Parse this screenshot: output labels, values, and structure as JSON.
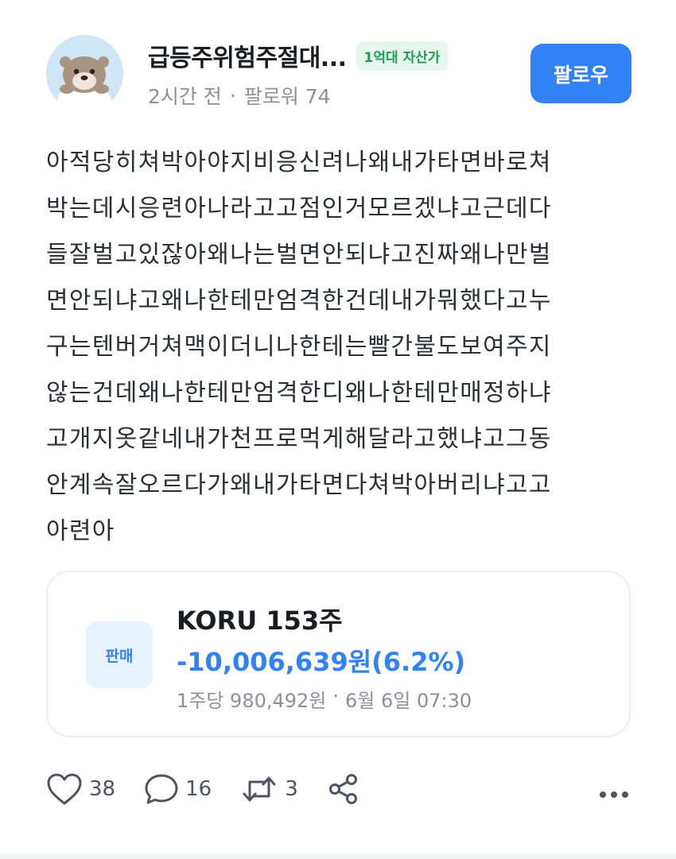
{
  "author": {
    "name": "급등주위험주절대...",
    "badge": "1억대 자산가",
    "time": "2시간 전",
    "separator": "·",
    "followers": "팔로워 74",
    "follow_label": "팔로우"
  },
  "post": {
    "lines": [
      "아적당히쳐박아야지비응신려나왜내가타면바로쳐",
      "박는데시응련아나라고고점인거모르겠냐고근데다",
      "들잘벌고있잖아왜나는벌면안되냐고진짜왜나만벌",
      "면안되냐고왜나한테만엄격한건데내가뭐했다고누",
      "구는텐버거쳐맥이더니나한테는빨간불도보여주지",
      "않는건데왜나한테만엄격한디왜나한테만매정하냐",
      "고개지옷같네내가천프로먹게해달라고했냐고그동",
      "안계속잘오르다가왜내가타면다쳐박아버리냐고고",
      "아련아"
    ]
  },
  "trade": {
    "type_label": "판매",
    "title": "KORU 153주",
    "amount": "-10,006,639원(6.2%)",
    "price_per_share": "1주당 980,492원",
    "separator": "·",
    "datetime": "6월 6일 07:30"
  },
  "actions": {
    "likes": "38",
    "comments": "16",
    "reposts": "3"
  },
  "colors": {
    "accent": "#3182f6",
    "badge_text": "#1f9d55",
    "badge_bg": "#e6f6ec",
    "muted_text": "#8b919a"
  },
  "icons": [
    "avatar-otter",
    "heart-icon",
    "comment-icon",
    "repost-icon",
    "share-icon",
    "more-icon"
  ]
}
